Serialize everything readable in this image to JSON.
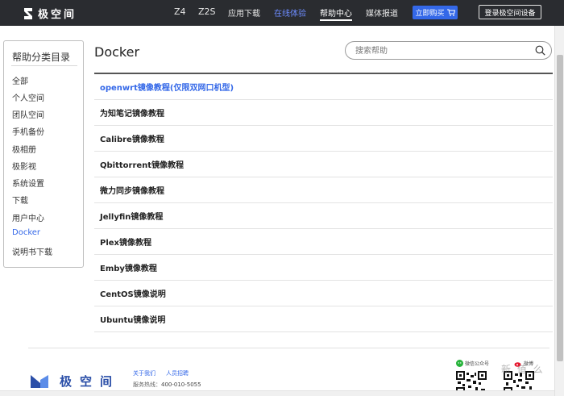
{
  "brand": {
    "name": "极空间"
  },
  "nav": {
    "items": [
      "Z4",
      "Z2S",
      "应用下载",
      "在线体验",
      "帮助中心",
      "媒体报道"
    ],
    "buy_label": "立即购买",
    "login_label": "登录极空间设备"
  },
  "sidebar": {
    "title": "帮助分类目录",
    "items": [
      "全部",
      "个人空间",
      "团队空间",
      "手机备份",
      "极相册",
      "极影视",
      "系统设置",
      "下载",
      "用户中心",
      "Docker",
      "说明书下载"
    ]
  },
  "main": {
    "title": "Docker",
    "search_placeholder": "搜索帮助",
    "articles": [
      "openwrt镜像教程(仅限双网口机型)",
      "为知笔记镜像教程",
      "Calibre镜像教程",
      "Qbittorrent镜像教程",
      "微力同步镜像教程",
      "Jellyfin镜像教程",
      "Plex镜像教程",
      "Emby镜像教程",
      "CentOS镜像说明",
      "Ubuntu镜像说明"
    ]
  },
  "footer": {
    "brand": "极空间",
    "about_label": "关于我们",
    "jobs_label": "人员招聘",
    "phone_label": "服务热线：",
    "phone": "400-010-5055",
    "wechat_label": "微信公众号",
    "weibo_label": "微博"
  },
  "watermark": "新 值 么",
  "colors": {
    "accent": "#3468e8",
    "nav_bg": "#2a2c30",
    "nav_highlight": "#6d8cff"
  }
}
